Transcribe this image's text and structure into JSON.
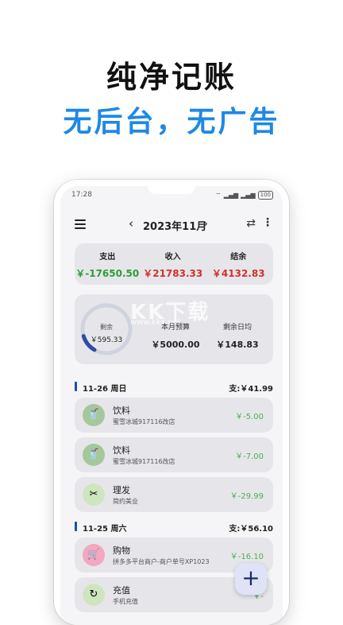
{
  "promo": {
    "title": "纯净记账",
    "subtitle": "无后台，无广告"
  },
  "status": {
    "time": "17:28",
    "battery": "100"
  },
  "header": {
    "prev": "‹",
    "month": "2023年11月",
    "next": "›",
    "swap_icon": "swap-person-icon",
    "more_icon": "more-vertical-icon"
  },
  "summary": [
    {
      "label": "支出",
      "value": "￥-17650.50",
      "color": "#2e9b3a"
    },
    {
      "label": "收入",
      "value": "￥21783.33",
      "color": "#d32f2f"
    },
    {
      "label": "结余",
      "value": "￥4132.83",
      "color": "#d32f2f"
    }
  ],
  "budget": {
    "remaining_label": "剩余",
    "remaining_value": "￥595.33",
    "monthly_label": "本月预算",
    "monthly_value": "￥5000.00",
    "daily_label": "剩余日均",
    "daily_value": "￥148.83",
    "used_fraction": 0.12,
    "watermark": "KK下载",
    "watermark_sub": "www.kkx.net"
  },
  "days": [
    {
      "date": "11-26 周日",
      "total": "支:￥41.99"
    },
    {
      "date": "11-25 周六",
      "total": "支:￥56.10"
    }
  ],
  "transactions": [
    {
      "icon": "cup-icon",
      "glyph": "🥤",
      "icon_bg": "#a5c89a",
      "name": "饮料",
      "note": "蜜雪冰城917116改店",
      "amount": "￥-5.00"
    },
    {
      "icon": "cup-icon",
      "glyph": "🥤",
      "icon_bg": "#a5c89a",
      "name": "饮料",
      "note": "蜜雪冰城917116改店",
      "amount": "￥-7.00"
    },
    {
      "icon": "scissors-icon",
      "glyph": "✂",
      "icon_bg": "#cfe5c0",
      "name": "理发",
      "note": "简约美业",
      "amount": "￥-29.99"
    },
    {
      "icon": "cart-icon",
      "glyph": "🛒",
      "icon_bg": "#f4a7c0",
      "name": "购物",
      "note": "拼多多平台商户-商户单号XP1023",
      "amount": "￥-16.10"
    },
    {
      "icon": "recharge-icon",
      "glyph": "↻",
      "icon_bg": "#cfe5c0",
      "name": "充值",
      "note": "手机充值",
      "amount": "￥-"
    }
  ],
  "fab": {
    "label": "+"
  }
}
